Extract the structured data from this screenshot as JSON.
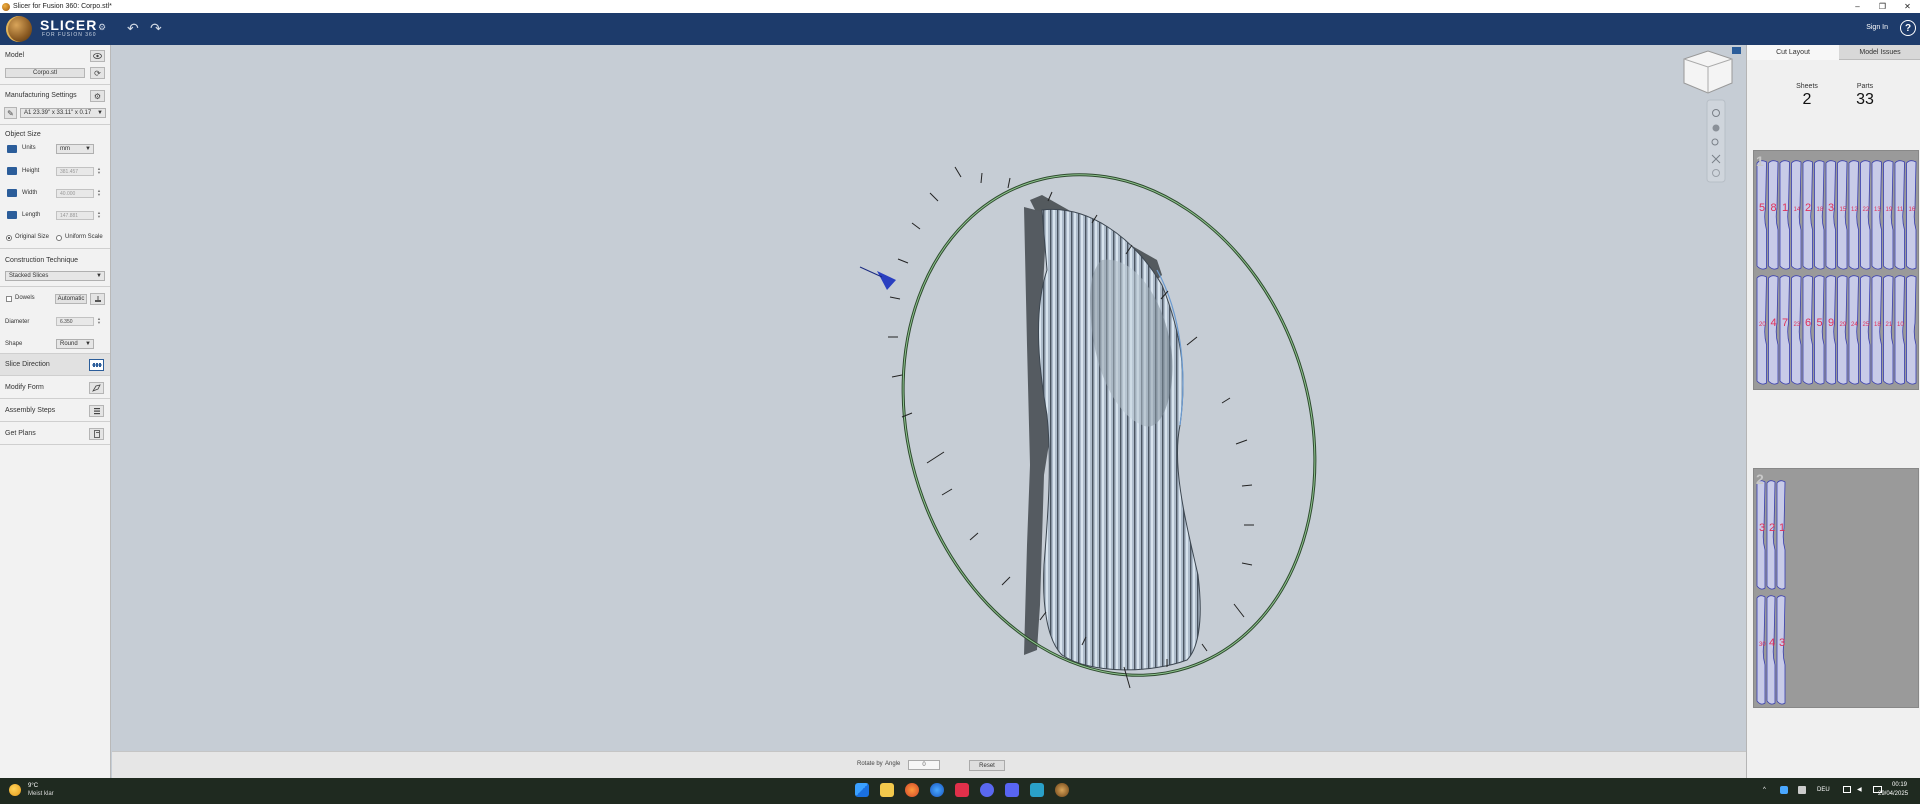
{
  "window": {
    "title": "Slicer for Fusion 360: Corpo.stl*",
    "minimize": "–",
    "maximize": "❐",
    "close": "✕"
  },
  "header": {
    "logo_text": "SLICER",
    "logo_sub": "FOR FUSION 360",
    "logo_gear": "⚙",
    "undo": "↶",
    "redo": "↷",
    "sign_in": "Sign In",
    "help": "?"
  },
  "left_panel": {
    "model_title": "Model",
    "model_file": "Corpo.stl",
    "manufacturing_title": "Manufacturing Settings",
    "manufacturing_value": "A1 23.39\" x 33.11\" x 0.17",
    "object_size_title": "Object Size",
    "units_label": "Units",
    "units_value": "mm",
    "height_label": "Height",
    "height_value": "381.457",
    "width_label": "Width",
    "width_value": "40.000",
    "length_label": "Length",
    "length_value": "147.881",
    "original_size": "Original Size",
    "uniform_scale": "Uniform Scale",
    "construction_title": "Construction Technique",
    "construction_value": "Stacked Slices",
    "dowels_label": "Dowels",
    "dowels_value": "Automatic",
    "diameter_label": "Diameter",
    "diameter_value": "6.350",
    "shape_label": "Shape",
    "shape_value": "Round",
    "steps": [
      {
        "label": "Slice Direction"
      },
      {
        "label": "Modify Form"
      },
      {
        "label": "Assembly Steps"
      },
      {
        "label": "Get Plans"
      }
    ]
  },
  "bottom_bar": {
    "rotate_by": "Rotate by",
    "angle": "Angle",
    "angle_value": "0",
    "reset": "Reset"
  },
  "right_panel": {
    "tab_cut_layout": "Cut Layout",
    "tab_model_issues": "Model Issues",
    "sheets_label": "Sheets",
    "sheets_value": "2",
    "parts_label": "Parts",
    "parts_value": "33",
    "sheet1": {
      "number": "1",
      "top_labels": [
        "5",
        "8",
        "1",
        "14",
        "2",
        "18",
        "3",
        "15",
        "12",
        "22",
        "13",
        "19",
        "11",
        "16"
      ],
      "bottom_labels": [
        "20",
        "4",
        "7",
        "23",
        "6",
        "5",
        "9",
        "29",
        "24",
        "25",
        "18",
        "21",
        "10"
      ]
    },
    "sheet2": {
      "number": "2",
      "top_labels": [
        "3",
        "2",
        "1"
      ],
      "bottom_labels": [
        "30",
        "4",
        "3"
      ]
    }
  },
  "taskbar": {
    "temperature": "9°C",
    "weather": "Meist klar",
    "lang": "DEU",
    "time": "00:19",
    "date": "29/04/2025",
    "caret": "^"
  },
  "colors": {
    "header_bg": "#1d3b6b",
    "viewport_bg": "#c6cdd5",
    "accent_blue": "#2b5d9a",
    "label_red": "#e0305a",
    "ring_green": "#5a8a5a"
  }
}
